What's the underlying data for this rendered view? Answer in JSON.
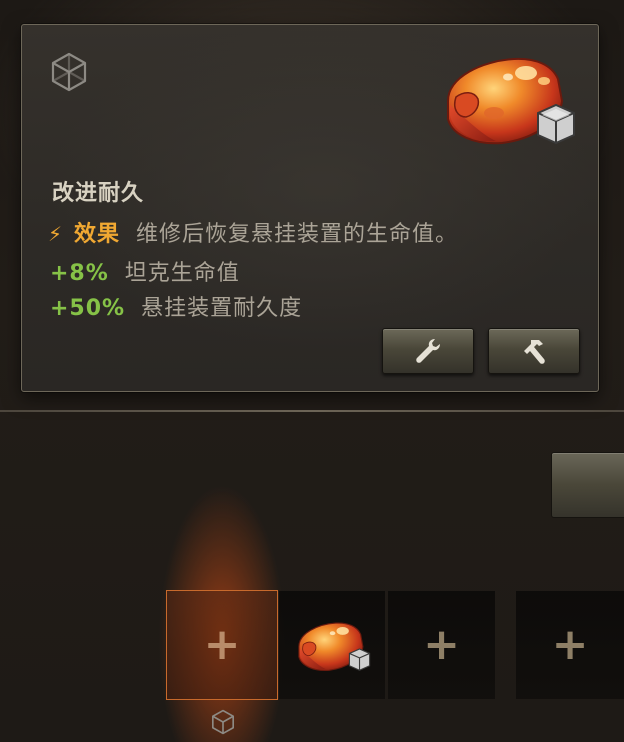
{
  "tooltip": {
    "title": "改进耐久",
    "effect_label": "效果",
    "effect_text": "维修后恢复悬挂装置的生命值。",
    "bonuses": [
      {
        "value": "+8%",
        "label": "坦克生命值"
      },
      {
        "value": "+50%",
        "label": "悬挂装置耐久度"
      }
    ],
    "colors": {
      "effect": "#f0a832",
      "bonus": "#86c247",
      "title": "#d8d2c2",
      "text": "#aba497"
    }
  },
  "icons": {
    "category": "cube-icon",
    "equipment": "suspension-equipment-icon",
    "tool_1": "wrench-icon",
    "tool_2": "hammer-icon"
  },
  "slots": {
    "plus_glyph": "+",
    "items": [
      {
        "state": "empty",
        "selected": true
      },
      {
        "state": "equipment"
      },
      {
        "state": "empty"
      },
      {
        "state": "empty"
      }
    ]
  }
}
